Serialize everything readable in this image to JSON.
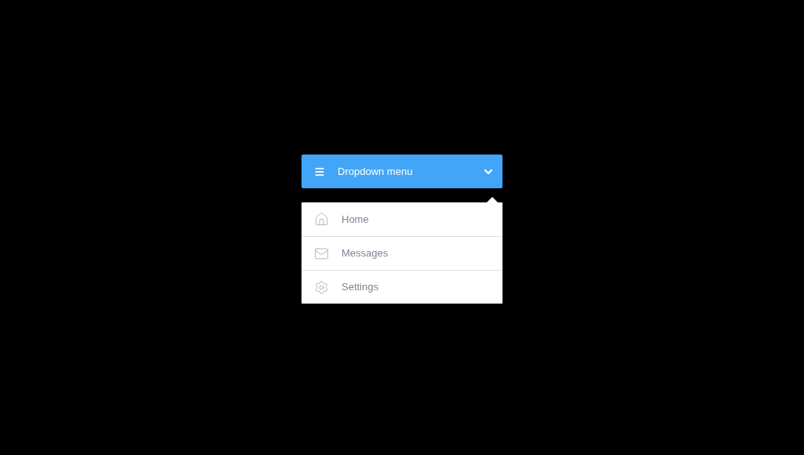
{
  "dropdown": {
    "label": "Dropdown menu",
    "expanded": true,
    "items": [
      {
        "kind": "home",
        "label": "Home"
      },
      {
        "kind": "mail",
        "label": "Messages"
      },
      {
        "kind": "gear",
        "label": "Settings"
      }
    ]
  }
}
